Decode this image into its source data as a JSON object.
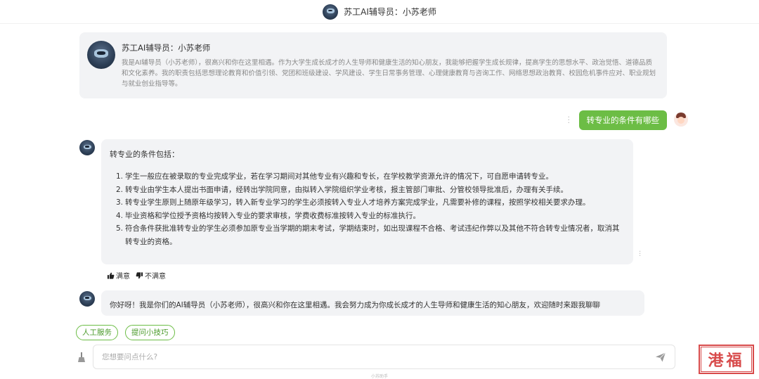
{
  "header": {
    "title": "苏工AI辅导员：小苏老师"
  },
  "intro": {
    "name": "苏工AI辅导员：小苏老师",
    "description": "我是AI辅导员（小苏老师），很高兴和你在这里相遇。作为大学生成长成才的人生导师和健康生活的知心朋友，我能够把握学生成长规律，提高学生的思想水平、政治觉悟、道德品质和文化素养。我的职责包括思想理论教育和价值引领、党团和班级建设、学风建设、学生日常事务管理、心理健康教育与咨询工作、网络思想政治教育、校园危机事件应对、职业规划与就业创业指导等。"
  },
  "user_message": {
    "text": "转专业的条件有哪些"
  },
  "bot_message_1": {
    "title": "转专业的条件包括：",
    "items": [
      {
        "num": "1.",
        "text": "学生一般应在被录取的专业完成学业，若在学习期间对其他专业有兴趣和专长，在学校教学资源允许的情况下，可自愿申请转专业。"
      },
      {
        "num": "2.",
        "text": "转专业由学生本人提出书面申请，经转出学院同意，由拟转入学院组织学业考核，报主管部门审批、分管校领导批准后，办理有关手续。"
      },
      {
        "num": "3.",
        "text": "转专业学生原则上随原年级学习，转入新专业学习的学生必须按转入专业人才培养方案完成学业，凡需要补修的课程，按照学校相关要求办理。"
      },
      {
        "num": "4.",
        "text": "毕业资格和学位授予资格均按转入专业的要求审核，学费收费标准按转入专业的标准执行。"
      },
      {
        "num": "5.",
        "text": "符合条件获批准转专业的学生必须参加原专业当学期的期末考试，学期结束时，如出现课程不合格、考试违纪作弊以及其他不符合转专业情况者，取消其转专业的资格。"
      }
    ]
  },
  "feedback": {
    "like": "满意",
    "dislike": "不满意"
  },
  "bot_message_2": {
    "text": "你好呀！我是你们的AI辅导员（小苏老师），很高兴和你在这里相遇。我会努力成为你成长成才的人生导师和健康生活的知心朋友，欢迎随时来跟我聊聊"
  },
  "chips": {
    "human_service": "人工服务",
    "tips": "提问小技巧"
  },
  "input": {
    "placeholder": "您想要问点什么?"
  },
  "footer": {
    "text": "小苏助手"
  },
  "stamp": {
    "text": "港福"
  },
  "icons": [
    "robot-avatar-icon",
    "user-avatar-icon",
    "thumbs-up-icon",
    "thumbs-down-icon",
    "broom-icon",
    "send-icon",
    "more-vertical-icon"
  ],
  "colors": {
    "accent": "#6cbd45",
    "bubble_bg": "#f2f3f5",
    "stamp": "#d84b4b"
  }
}
